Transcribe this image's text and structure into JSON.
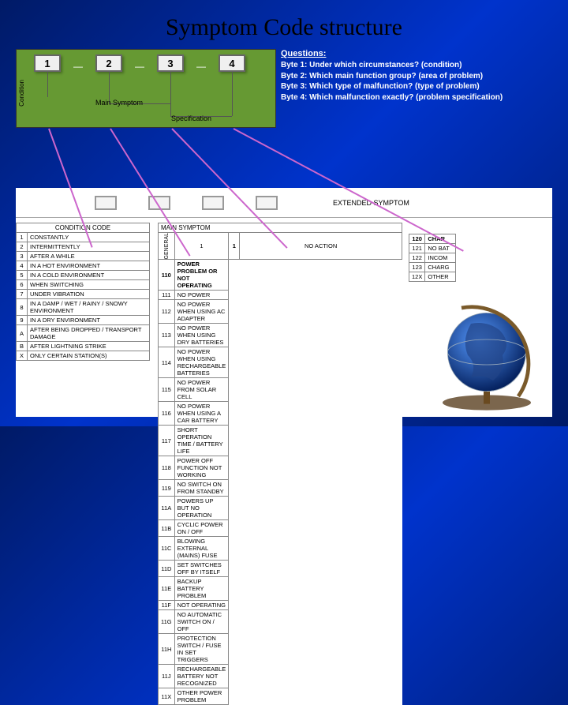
{
  "title": "Symptom Code structure",
  "diagram": {
    "bytes": [
      "1",
      "2",
      "3",
      "4"
    ],
    "condition_label": "Condition",
    "main_symptom_label": "Main Symptom",
    "specification_label": "Specification"
  },
  "questions": {
    "header": "Questions:",
    "lines": [
      "Byte 1: Under which circumstances? (condition)",
      "Byte 2: Which main function group? (area of problem)",
      "Byte 3: Which type of malfunction? (type of problem)",
      "Byte 4: Which malfunction exactly? (problem specification)"
    ]
  },
  "extended_label": "EXTENDED SYMPTOM",
  "condition_table": {
    "header": "CONDITION CODE",
    "rows": [
      {
        "code": "1",
        "text": "CONSTANTLY"
      },
      {
        "code": "2",
        "text": "INTERMITTENTLY"
      },
      {
        "code": "3",
        "text": "AFTER A WHILE"
      },
      {
        "code": "4",
        "text": "IN A HOT ENVIRONMENT"
      },
      {
        "code": "5",
        "text": "IN A COLD ENVIRONMENT"
      },
      {
        "code": "6",
        "text": "WHEN SWITCHING"
      },
      {
        "code": "7",
        "text": "UNDER VIBRATION"
      },
      {
        "code": "8",
        "text": "IN A DAMP / WET / RAINY / SNOWY ENVIRONMENT"
      },
      {
        "code": "9",
        "text": "IN A DRY ENVIRONMENT"
      },
      {
        "code": "A",
        "text": "AFTER BEING DROPPED / TRANSPORT DAMAGE"
      },
      {
        "code": "B",
        "text": "AFTER LIGHTNING STRIKE"
      },
      {
        "code": "X",
        "text": "ONLY CERTAIN STATION(S)"
      }
    ]
  },
  "main_symptom_table": {
    "header": "MAIN SYMPTOM",
    "vlabel": "GENERAL",
    "group_code": "1",
    "title_row": {
      "code": "1",
      "text": "NO ACTION"
    },
    "rows": [
      {
        "code": "110",
        "text": "POWER PROBLEM OR NOT OPERATING"
      },
      {
        "code": "111",
        "text": "NO POWER"
      },
      {
        "code": "112",
        "text": "NO POWER WHEN USING AC ADAPTER"
      },
      {
        "code": "113",
        "text": "NO POWER WHEN USING DRY BATTERIES"
      },
      {
        "code": "114",
        "text": "NO POWER WHEN USING RECHARGEABLE BATTERIES"
      },
      {
        "code": "115",
        "text": "NO POWER FROM SOLAR CELL"
      },
      {
        "code": "116",
        "text": "NO POWER WHEN USING A CAR BATTERY"
      },
      {
        "code": "117",
        "text": "SHORT OPERATION TIME / BATTERY LIFE"
      },
      {
        "code": "118",
        "text": "POWER OFF FUNCTION NOT WORKING"
      },
      {
        "code": "119",
        "text": "NO SWITCH ON FROM STANDBY"
      },
      {
        "code": "11A",
        "text": "POWERS UP BUT NO OPERATION"
      },
      {
        "code": "11B",
        "text": "CYCLIC POWER ON / OFF"
      },
      {
        "code": "11C",
        "text": "BLOWING EXTERNAL (MAINS) FUSE"
      },
      {
        "code": "11D",
        "text": "SET SWITCHES OFF BY ITSELF"
      },
      {
        "code": "11E",
        "text": "BACKUP BATTERY PROBLEM"
      },
      {
        "code": "11F",
        "text": "NOT OPERATING"
      },
      {
        "code": "11G",
        "text": "NO AUTOMATIC SWITCH ON / OFF"
      },
      {
        "code": "11H",
        "text": "PROTECTION SWITCH / FUSE IN SET TRIGGERS"
      },
      {
        "code": "11J",
        "text": "RECHARGEABLE BATTERY NOT RECOGNIZED"
      },
      {
        "code": "11X",
        "text": "OTHER POWER PROBLEM"
      }
    ]
  },
  "right_table": {
    "rows": [
      {
        "code": "120",
        "text": "CHAR"
      },
      {
        "code": "121",
        "text": "NO BAT"
      },
      {
        "code": "122",
        "text": "INCOM"
      },
      {
        "code": "123",
        "text": "CHARG"
      },
      {
        "code": "12X",
        "text": "OTHER"
      }
    ]
  }
}
